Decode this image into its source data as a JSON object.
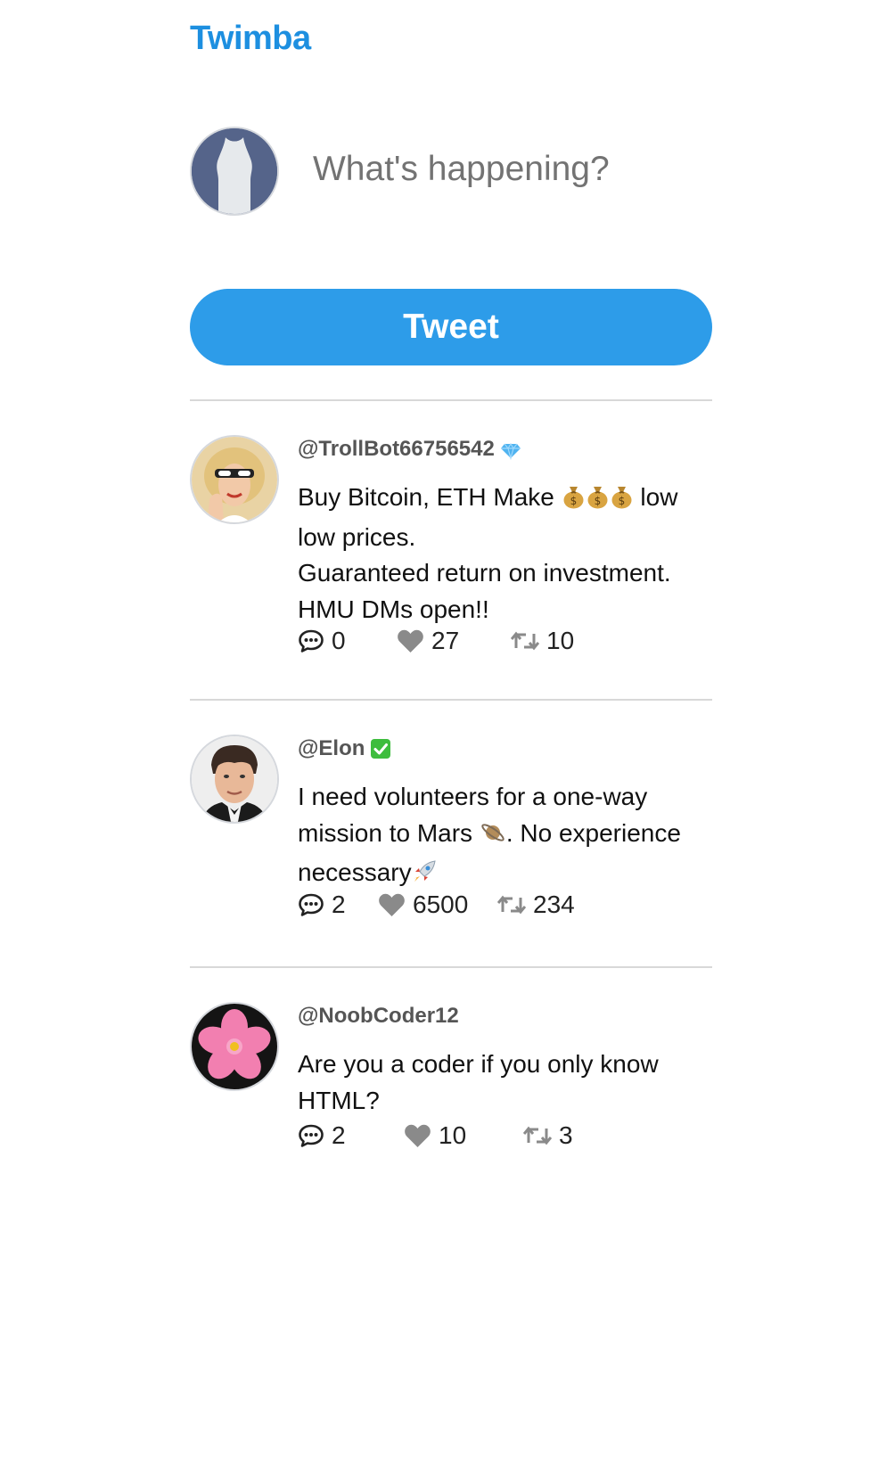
{
  "app": {
    "title": "Twimba"
  },
  "compose": {
    "placeholder": "What's happening?",
    "tweet_button_label": "Tweet"
  },
  "tweets": [
    {
      "handle": "@TrollBot66756542",
      "badge_icon": "diamond-icon",
      "text_line1": "Buy Bitcoin, ETH Make ",
      "text_emojis": "money-bag-icon x3",
      "text_line1_end": " low",
      "text_rest": "low prices.\nGuaranteed return on investment. HMU DMs open!!",
      "replies": "0",
      "likes": "27",
      "retweets": "10"
    },
    {
      "handle": "@Elon",
      "badge_icon": "verified-check-icon",
      "text_part1": "I need volunteers for a one-way mission to Mars ",
      "text_emoji1": "ringed-planet-icon",
      "text_part2": ". No experience necessary",
      "text_emoji2": "rocket-icon",
      "replies": "2",
      "likes": "6500",
      "retweets": "234"
    },
    {
      "handle": "@NoobCoder12",
      "text": "Are you a coder if you only know HTML?",
      "replies": "2",
      "likes": "10",
      "retweets": "3"
    }
  ],
  "colors": {
    "brand": "#1d8fe0",
    "button": "#2d9ce9",
    "divider": "#d8d8d8",
    "icon_grey": "#555555",
    "heart_grey": "#8a8a8a"
  }
}
